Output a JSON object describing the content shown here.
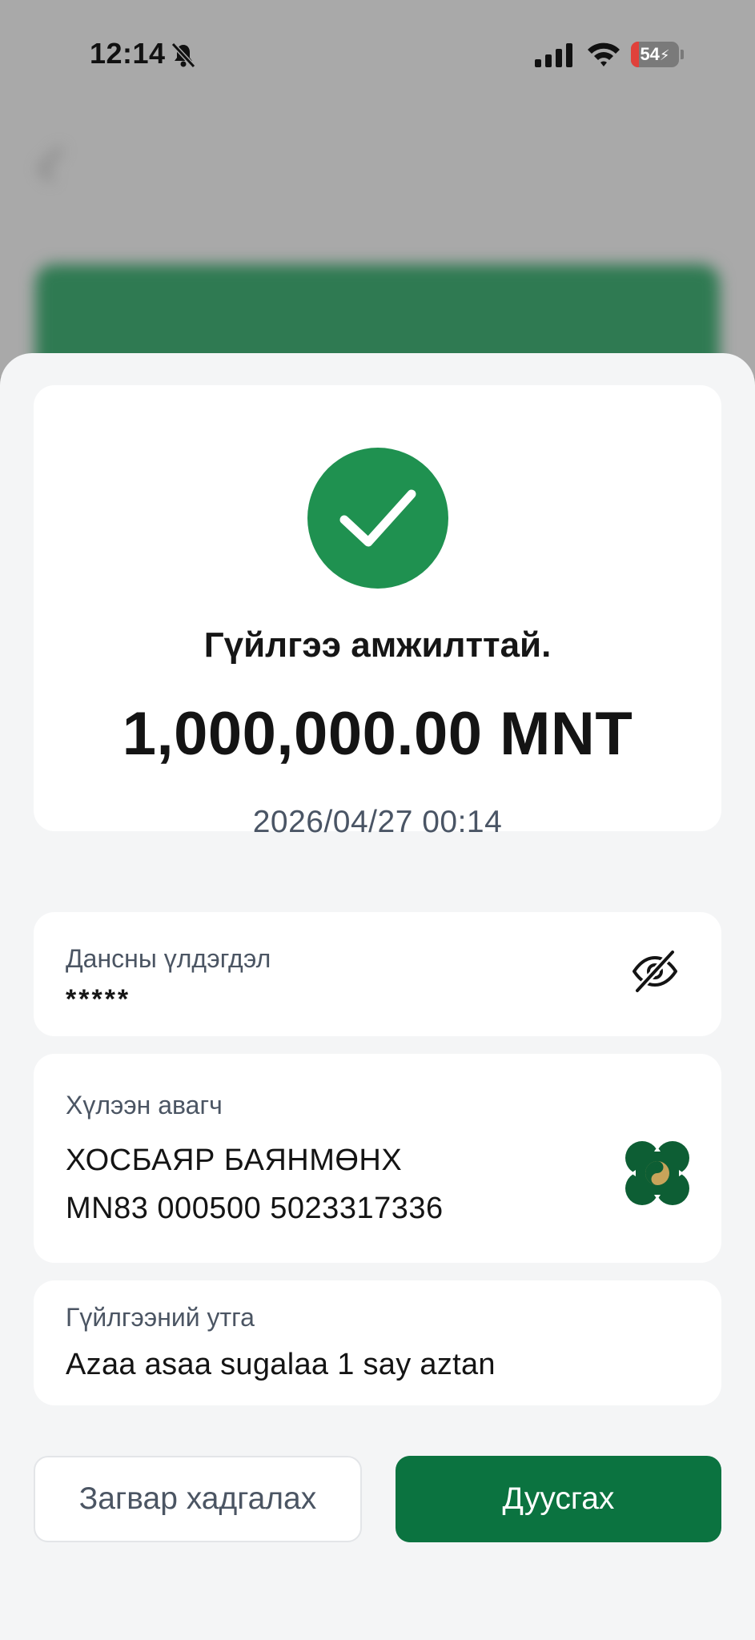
{
  "status_bar": {
    "time": "12:14",
    "battery_level": "54",
    "icons": [
      "bell-slash-icon",
      "signal-icon",
      "wifi-icon",
      "battery-icon"
    ]
  },
  "background": {
    "title": "",
    "subtitle": "",
    "banner_text": ""
  },
  "sheet": {
    "success_icon": "check-icon",
    "success_title": "Гүйлгээ амжилттай.",
    "amount": "1,000,000.00 MNT",
    "datetime": "2026/04/27 00:14",
    "balance": {
      "label": "Дансны үлдэгдэл",
      "value": "*****",
      "toggle_icon": "eye-slash-icon"
    },
    "recipient": {
      "label": "Хүлээн авагч",
      "name": "ХОСБАЯР БАЯНМӨНХ",
      "account": "MN83 000500 5023317336",
      "bank_icon": "bank-logo-icon"
    },
    "purpose": {
      "label": "Гүйлгээний утга",
      "value": "Azaa asaa sugalaa 1 say aztan"
    },
    "buttons": {
      "save_template": "Загвар хадгалах",
      "finish": "Дуусгах"
    }
  },
  "colors": {
    "success_green": "#1f9150",
    "primary_button": "#0b7340",
    "bank_green": "#0d5e34",
    "bank_gold": "#c8a45a"
  }
}
